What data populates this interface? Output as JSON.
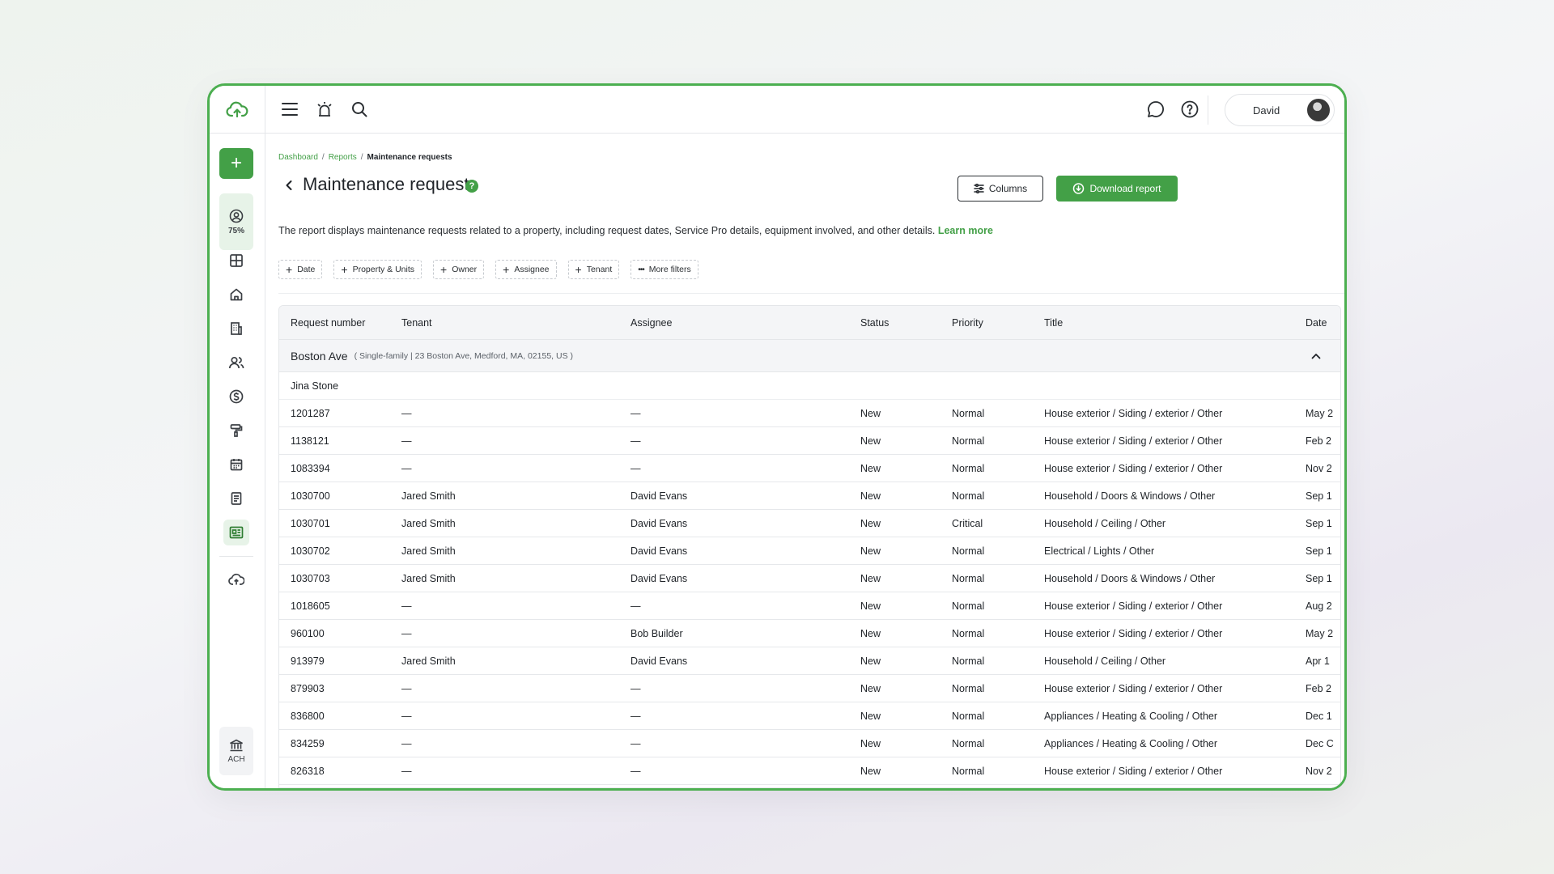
{
  "header": {
    "user_name": "David"
  },
  "sidebar": {
    "progress_label": "75%",
    "ach_label": "ACH"
  },
  "breadcrumb": {
    "items": [
      "Dashboard",
      "Reports"
    ],
    "separator": "/",
    "current": "Maintenance requests"
  },
  "page": {
    "title": "Maintenance requests",
    "help": "?",
    "description": "The report displays maintenance requests related to a property, including request dates, Service Pro details, equipment involved, and other details.",
    "learn_more": "Learn more",
    "columns_button": "Columns",
    "download_button": "Download report"
  },
  "filters": [
    "Date",
    "Property & Units",
    "Owner",
    "Assignee",
    "Tenant",
    "More filters"
  ],
  "table": {
    "columns": [
      "Request number",
      "Tenant",
      "Assignee",
      "Status",
      "Priority",
      "Title",
      "Date"
    ],
    "group": {
      "name": "Boston Ave",
      "detail": "( Single-family | 23 Boston Ave, Medford, MA, 02155, US )"
    },
    "subgroup": "Jina Stone",
    "rows": [
      [
        "1201287",
        "—",
        "—",
        "New",
        "Normal",
        "House exterior / Siding / exterior / Other",
        "May 2"
      ],
      [
        "1138121",
        "—",
        "—",
        "New",
        "Normal",
        "House exterior / Siding / exterior / Other",
        "Feb 2"
      ],
      [
        "1083394",
        "—",
        "—",
        "New",
        "Normal",
        "House exterior / Siding / exterior / Other",
        "Nov 2"
      ],
      [
        "1030700",
        "Jared Smith",
        "David Evans",
        "New",
        "Normal",
        "Household / Doors & Windows / Other",
        "Sep 1"
      ],
      [
        "1030701",
        "Jared Smith",
        "David Evans",
        "New",
        "Critical",
        "Household / Ceiling / Other",
        "Sep 1"
      ],
      [
        "1030702",
        "Jared Smith",
        "David Evans",
        "New",
        "Normal",
        "Electrical / Lights / Other",
        "Sep 1"
      ],
      [
        "1030703",
        "Jared Smith",
        "David Evans",
        "New",
        "Normal",
        "Household / Doors & Windows / Other",
        "Sep 1"
      ],
      [
        "1018605",
        "—",
        "—",
        "New",
        "Normal",
        "House exterior / Siding / exterior / Other",
        "Aug 2"
      ],
      [
        "960100",
        "—",
        "Bob Builder",
        "New",
        "Normal",
        "House exterior / Siding / exterior / Other",
        "May 2"
      ],
      [
        "913979",
        "Jared Smith",
        "David Evans",
        "New",
        "Normal",
        "Household / Ceiling / Other",
        "Apr 1"
      ],
      [
        "879903",
        "—",
        "—",
        "New",
        "Normal",
        "House exterior / Siding / exterior / Other",
        "Feb 2"
      ],
      [
        "836800",
        "—",
        "—",
        "New",
        "Normal",
        "Appliances / Heating & Cooling / Other",
        "Dec 1"
      ],
      [
        "834259",
        "—",
        "—",
        "New",
        "Normal",
        "Appliances / Heating & Cooling / Other",
        "Dec C"
      ],
      [
        "826318",
        "—",
        "—",
        "New",
        "Normal",
        "House exterior / Siding / exterior / Other",
        "Nov 2"
      ]
    ]
  },
  "colors": {
    "accent": "#43a047",
    "accent_light": "#e7f3e8",
    "border": "#4caf50"
  },
  "icons": {
    "logo": "cloud-upload-icon",
    "menu": "hamburger-menu-icon",
    "alarm": "alarm-bell-icon",
    "search": "search-icon",
    "chat": "chat-icon",
    "help": "question-icon"
  }
}
